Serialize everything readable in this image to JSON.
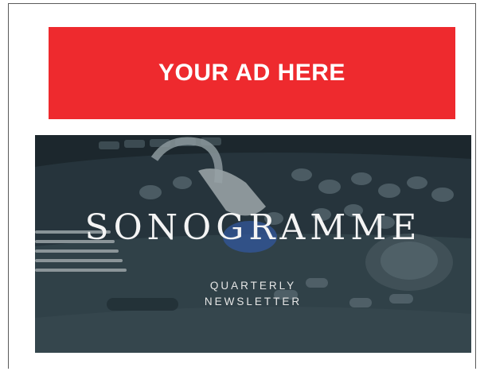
{
  "ad": {
    "label": "YOUR AD HERE",
    "color": "#ee2a2e"
  },
  "banner": {
    "title": "SONOGRAMME",
    "subtitle_line1": "QUARTERLY",
    "subtitle_line2": "NEWSLETTER"
  }
}
